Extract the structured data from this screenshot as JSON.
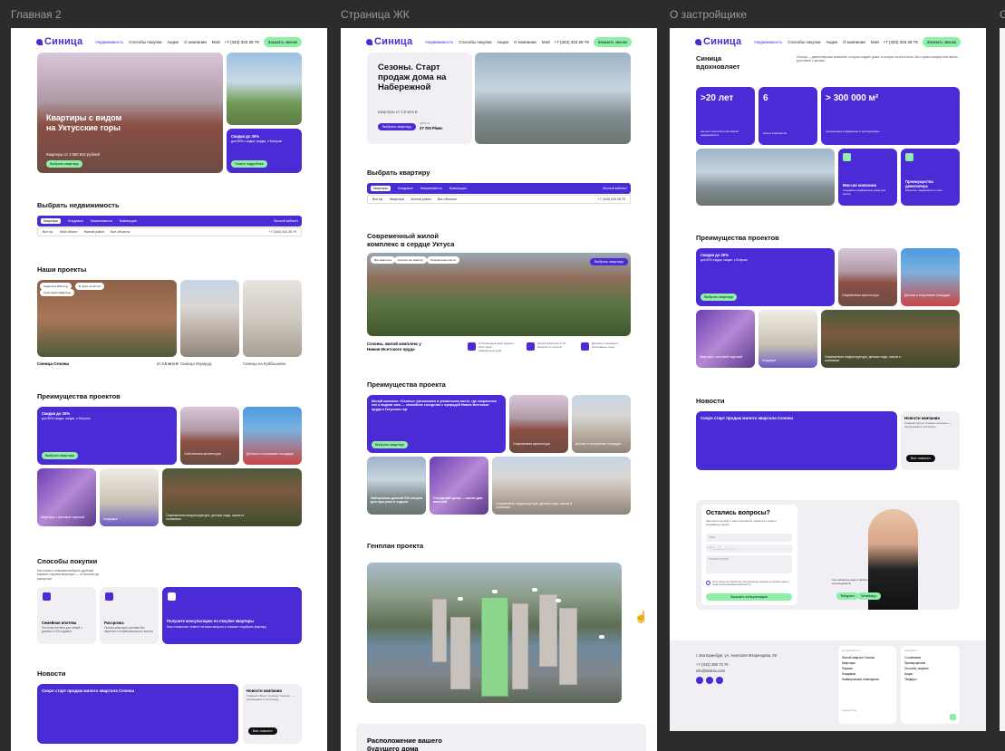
{
  "frames": {
    "f1": {
      "label": "Главная 2"
    },
    "f2": {
      "label": "Страница ЖК"
    },
    "f3": {
      "label": "О застройщике"
    }
  },
  "header": {
    "logo": "Синица",
    "nav": [
      "Недвижимость",
      "Способы покупки",
      "Акции",
      "О компании",
      "Мой"
    ],
    "phone": "+7 (343) 343 28 79",
    "call_button": "Заказать звонок"
  },
  "home": {
    "hero_title": "Квартиры с видом на Уктусские горы",
    "hero_sub": "Квартиры от 3 560 842 рублей",
    "hero_button": "Выбрать квартиру",
    "promo_title": "Скидки до 25%",
    "promo_text": "для 80% с кидки, скидки, с бонусом",
    "promo_button": "Узнать подробнее",
    "choose_title": "Выбрать недвижимость",
    "tabs": [
      "Квартиры",
      "Кладовые",
      "Машиноместа",
      "Коммерция"
    ],
    "tabs_right": "Личный кабинет",
    "filters": [
      "Все пр.",
      "Мой объект",
      "Жилой район",
      "Все объекты"
    ],
    "filter_phone": "+7 (343) 343 28 79",
    "projects_title": "Наши проекты",
    "projects": [
      {
        "name": "Синица Сезоны",
        "tags": [
          "Сдается в 2024 год",
          "В черте за 10 лет",
          "Срок сдачи Квартиры"
        ],
        "price": "от 3,5 млн ₽"
      },
      {
        "name": "Синица Изумруд"
      },
      {
        "name": "Синица на Куйбышева"
      }
    ],
    "advantages_title": "Преимущества проектов",
    "adv_promo_title": "Скидки до 25%",
    "adv_promo_text": "для 80% скидки, скидки, с бонусом",
    "adv_promo_button": "Выбрать квартиру",
    "adv_items": [
      "Собственная архитектура",
      "Детская и спортивные площадки",
      "Квартиры с чистовой отделкой",
      "Кладовые",
      "Современная инфраструктура: детские сады, школы в основании"
    ],
    "buy_title": "Способы покупки",
    "buy_text": "Мы гоним и поможем выбрать удобный вариант покупки квартиры — от ипотеки до рассрочки",
    "buy_items": [
      {
        "title": "Семейная ипотека",
        "text": "Льготная ипотека для семей с детьми от 6% годовых"
      },
      {
        "title": "Рассрочка",
        "text": "Оплата квартиры частями без переплат и первоначального взноса"
      },
      {
        "title": "Получите консультацию по покупке квартиры",
        "text": "Наш специалист ответит на ваши вопросы и поможет подобрать квартиру"
      }
    ],
    "news_title": "Новости",
    "news_main_title": "Скоро старт продаж жилого квартала Сезоны",
    "news_side_title": "Новости компании",
    "news_side_text": "Главный объект Синица \"Сезоны\" — распродажа в гостиницы",
    "news_side_button": "Все новости"
  },
  "complex": {
    "hero_title": "Сезоны. Старт продаж дома на Набережной",
    "hero_sub": "Квартиры от 4,5 млн ₽",
    "hero_button": "Выбрать квартиру",
    "hero_price_label": "цена от",
    "hero_price": "27 700 Р/мес",
    "choose_title": "Выбрать квартиру",
    "tabs": [
      "Квартиры",
      "Кладовые",
      "Машиноместа",
      "Коммерция"
    ],
    "tabs_right": "Личный кабинет",
    "filters": [
      "Все пр.",
      "Квартиры",
      "Жилой район",
      "Все объекты"
    ],
    "filter_phone": "+7 (343) 343 28 79",
    "modern_title": "Современный жилой комплекс в сердце Уктуса",
    "modern_tags": [
      "Все квартиры",
      "Количество квартир",
      "Парковочные места"
    ],
    "modern_button": "Выбрать квартиру",
    "modern_caption": "Сезоны, жилой комплекс у Нижне-Исетского пруда",
    "modern_feats": [
      "Собственный двор рядом с ЖК и всей инфраструктурой",
      "Жилой Комплекс в 15 минутах от центра",
      "Детские площадки и спортивные зоны"
    ],
    "adv_title": "Преимущества проекта",
    "adv_main_text": "Жилой комплекс «Сезоны» расположен в уникальном месте, где сохранился лес и водная зона — спокойное соседство с природой Нижне-Исетского пруда и Уктусских гор.",
    "adv_button": "Выбрать квартиру",
    "adv_items": [
      "Современная архитектура",
      "Детские и спортивные площадки",
      "Набережная длиной 630 метров для прогулок и отдыха",
      "Соседский центр — место для жителей",
      "Современная инфраструктура: детские сады, школы в основании"
    ],
    "genplan_title": "Генплан проекта",
    "location_title": "Расположение вашего будущего дома"
  },
  "developer": {
    "title": "Синица вдохновляет",
    "intro": "Синица — девелоперская компания, которая создает дома, в которых хочется жить. Мы строим комфортное жилье для семей с детьми.",
    "stats": [
      {
        "value": ">20 лет",
        "text": "опыта в строительстве жилой недвижимости"
      },
      {
        "value": "6",
        "text": "жилых комплексов"
      },
      {
        "value": "> 300 000 м²",
        "text": "построенных и введенных в эксплуатацию"
      }
    ],
    "mission": [
      {
        "title": "Миссия компании",
        "text": "Создавать комфортные дома для жизни"
      },
      {
        "title": "Преимущества девелопера",
        "text": "Качество, надежность и опыт"
      }
    ],
    "projects_title": "Преимущества проектов",
    "promo_title": "Скидки до 25%",
    "promo_text": "для 80% скидки, скидки, с бонусом",
    "promo_button": "Выбрать квартиру",
    "adv_items": [
      "Современная архитектура",
      "Детские и спортивные площадки",
      "Квартиры с чистовой отделкой",
      "Кладовые",
      "Современная инфраструктура, детские сады, школы в основании"
    ],
    "news_title": "Новости",
    "news_main_title": "Скоро старт продаж жилого квартала Сезоны",
    "news_side_title": "Новости компании",
    "news_side_text": "Главный объект Синица «Сезоны» — распродажа в гостиницы",
    "news_side_button": "Все новости",
    "questions_title": "Остались вопросы?",
    "questions_text": "Заполните форму, и наш специалист свяжется с вами в ближайшее время",
    "fields": [
      "Имя",
      "+7 (___) ___-__-__",
      "Комментарий"
    ],
    "consent": "Я согласен на обработку персональных данных в соответствии с политикой конфиденциальности",
    "submit": "Заказать консультацию",
    "person_caption": "или напишите нам в любом из мессенджеров",
    "messengers": [
      "Telegram",
      "WhatsApp"
    ],
    "footer": {
      "address": "г. Екатеринбург, ул. Анатолия Мехренцева, 28",
      "phone": "+7 (343) 288 79 70",
      "email": "info@sinitsa.com",
      "col1_head": "Недвижимость",
      "col1": [
        "Жилой квартал Сезоны",
        "Квартиры",
        "Паркинг",
        "Кладовые",
        "Коммерческие помещения"
      ],
      "col2_head": "Компания",
      "col2": [
        "О компании",
        "Преимущества",
        "Способы покупки",
        "Акции",
        "Тендеры"
      ],
      "dev_label": "Разработка"
    }
  },
  "colors": {
    "accent": "#4b2bd6",
    "mint": "#8ef0a7",
    "canvas": "#2c2c2c",
    "panel": "#f1eff4"
  }
}
